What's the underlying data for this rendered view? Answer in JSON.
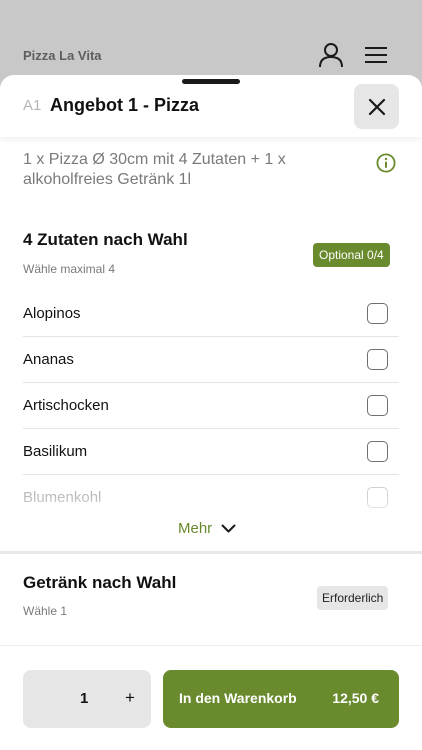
{
  "background": {
    "restaurant_name": "Pizza La Vita",
    "icons": [
      "user-icon",
      "menu-icon"
    ]
  },
  "sheet": {
    "code": "A1",
    "title": "Angebot 1 - Pizza",
    "description": "1 x Pizza Ø 30cm mit 4 Zutaten + 1 x alkoholfreies Getränk 1l"
  },
  "toppings": {
    "title": "4 Zutaten nach Wahl",
    "subtitle": "Wähle maximal 4",
    "badge": "Optional 0/4",
    "options": [
      {
        "label": "Alopinos",
        "checked": false
      },
      {
        "label": "Ananas",
        "checked": false
      },
      {
        "label": "Artischocken",
        "checked": false
      },
      {
        "label": "Basilikum",
        "checked": false
      },
      {
        "label": "Blumenkohl",
        "checked": false
      }
    ],
    "more_label": "Mehr"
  },
  "drink": {
    "title": "Getränk nach Wahl",
    "subtitle": "Wähle 1",
    "badge": "Erforderlich"
  },
  "footer": {
    "quantity": "1",
    "plus": "+",
    "cart_label": "In den Warenkorb",
    "price": "12,50 €"
  },
  "colors": {
    "accent": "#6a8a2e",
    "neutral_button": "#e6e6e6"
  }
}
